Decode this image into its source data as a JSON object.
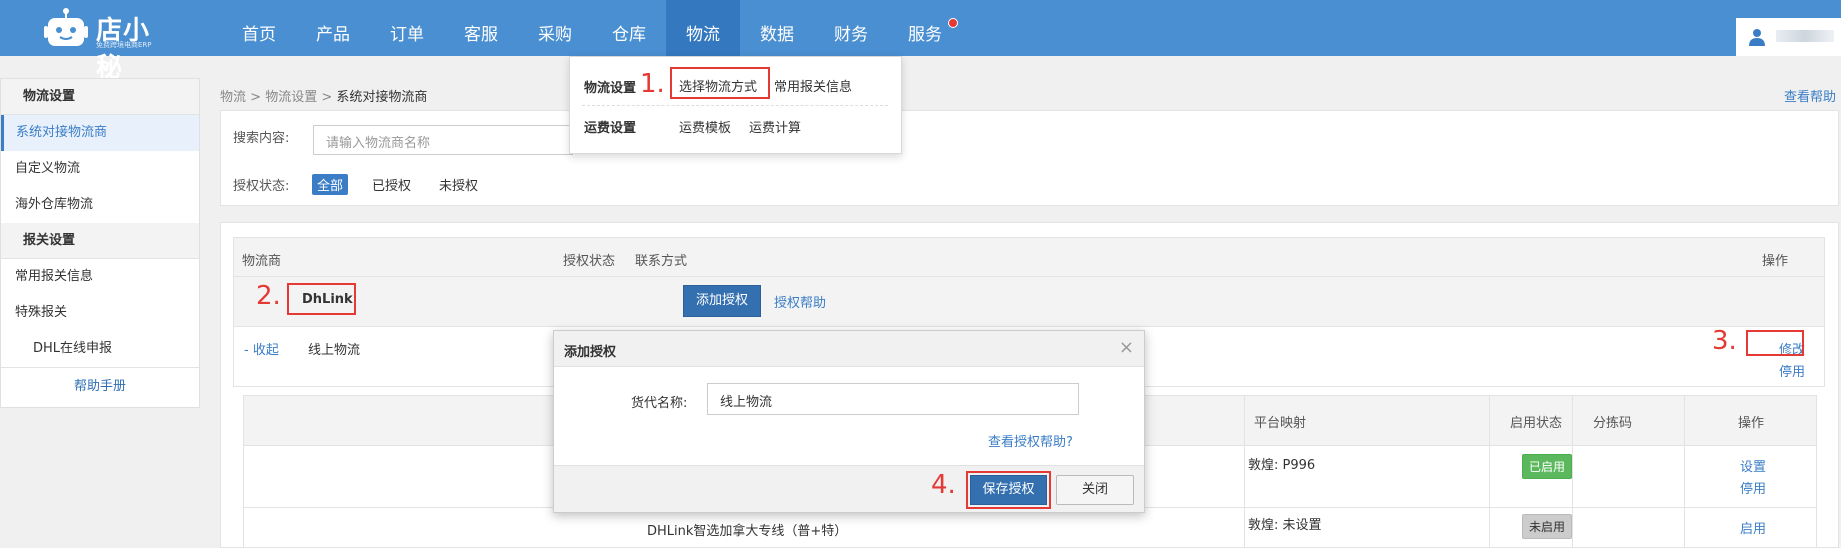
{
  "header": {
    "logo_title": "店小秘",
    "logo_subtitle": "免费跨境电商ERP",
    "nav": [
      "首页",
      "产品",
      "订单",
      "客服",
      "采购",
      "仓库",
      "物流",
      "数据",
      "财务",
      "服务"
    ],
    "active_nav": "物流"
  },
  "dropdown": {
    "row1_label": "物流设置",
    "row1_items": [
      "选择物流方式",
      "常用报关信息"
    ],
    "row2_label": "运费设置",
    "row2_items": [
      "运费模板",
      "运费计算"
    ]
  },
  "sidebar": {
    "group1": "物流设置",
    "group1_items": [
      "系统对接物流商",
      "自定义物流",
      "海外仓库物流"
    ],
    "group2": "报关设置",
    "group2_items": [
      "常用报关信息",
      "特殊报关",
      "DHL在线申报"
    ],
    "help": "帮助手册"
  },
  "breadcrumb": [
    "物流",
    "物流设置",
    "系统对接物流商"
  ],
  "help_link": "查看帮助",
  "search": {
    "label": "搜索内容:",
    "placeholder": "请输入物流商名称",
    "auth_label": "授权状态:",
    "filters": [
      "全部",
      "已授权",
      "未授权"
    ]
  },
  "table": {
    "headers": [
      "物流商",
      "授权状态",
      "联系方式",
      "操作"
    ],
    "provider": "DhLink",
    "add_auth_button": "添加授权",
    "auth_help_link": "授权帮助",
    "collapse_link": "- 收起",
    "service_name": "线上物流",
    "edit_link": "修改",
    "disable_link": "停用",
    "inner_headers": [
      "平台映射",
      "启用状态",
      "分拣码",
      "操作"
    ],
    "inner_rows": [
      {
        "name": "",
        "mapping": "敦煌: P996",
        "status": "已启用",
        "actions": [
          "设置",
          "停用"
        ]
      },
      {
        "name": "DHLink智选加拿大专线（普+特）",
        "mapping": "敦煌: 未设置",
        "status": "未启用",
        "actions": [
          "启用"
        ]
      }
    ]
  },
  "modal": {
    "title": "添加授权",
    "field_label": "货代名称:",
    "field_value": "线上物流",
    "help_link": "查看授权帮助?",
    "save_button": "保存授权",
    "close_button": "关闭"
  },
  "annotations": [
    "1.",
    "2.",
    "3.",
    "4."
  ],
  "colors": {
    "header_bg": "#4a8fd1",
    "primary_button": "#3470b0",
    "annotation_red": "#e53935",
    "enabled_green": "#5cb85c"
  }
}
